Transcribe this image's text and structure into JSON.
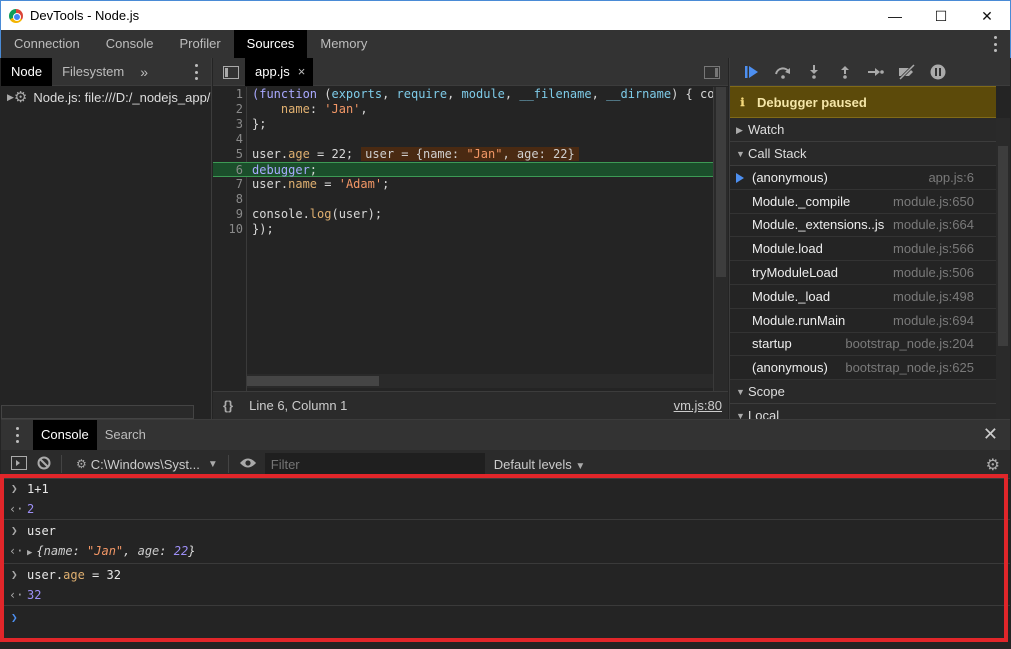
{
  "window": {
    "title": "DevTools - Node.js",
    "controls": {
      "minimize": "—",
      "maximize": "☐",
      "close": "✕"
    }
  },
  "main_tabs": [
    {
      "label": "Connection"
    },
    {
      "label": "Console"
    },
    {
      "label": "Profiler"
    },
    {
      "label": "Sources",
      "active": true
    },
    {
      "label": "Memory"
    }
  ],
  "navigator": {
    "tabs": [
      {
        "label": "Node",
        "active": true
      },
      {
        "label": "Filesystem"
      }
    ],
    "more": "»",
    "tree": [
      {
        "label": "Node.js: file:///D:/_nodejs_app/app.js"
      }
    ]
  },
  "editor": {
    "file_tab": "app.js",
    "close": "×",
    "lines": [
      {
        "n": "1"
      },
      {
        "n": "2"
      },
      {
        "n": "3"
      },
      {
        "n": "4"
      },
      {
        "n": "5"
      },
      {
        "n": "6"
      },
      {
        "n": "7"
      },
      {
        "n": "8"
      },
      {
        "n": "9"
      },
      {
        "n": "10"
      }
    ],
    "code": {
      "l1": {
        "kw": "(function",
        "sp1": " (",
        "p1": "exports",
        "c1": ", ",
        "p2": "require",
        "c2": ", ",
        "p3": "module",
        "c3": ", ",
        "p4": "__filename",
        "c4": ", ",
        "p5": "__dirname",
        "end": ") { con"
      },
      "l2": {
        "indent": "    ",
        "key": "name",
        "colon": ": ",
        "val": "'Jan'",
        "comma": ","
      },
      "l3": {
        "text": "};"
      },
      "l5": {
        "a": "user.",
        "prop": "age",
        "b": " = 22;",
        "inline_pre": "user = {name: ",
        "inline_str": "\"Jan\"",
        "inline_post": ", age: 22}"
      },
      "l6": {
        "kw": "debugger",
        "semi": ";"
      },
      "l7": {
        "a": "user.",
        "prop": "name",
        "b": " = ",
        "str": "'Adam'",
        "semi": ";"
      },
      "l9": {
        "a": "console.",
        "prop": "log",
        "b": "(user);"
      },
      "l10": {
        "text": "});"
      }
    },
    "status": {
      "braces": "{}",
      "position": "Line 6, Column 1",
      "source_link": "vm.js:80"
    }
  },
  "debugger": {
    "toolbar": [
      "resume-icon",
      "step-over-icon",
      "step-into-icon",
      "step-out-icon",
      "step-icon",
      "deactivate-breakpoints-icon",
      "pause-on-exceptions-icon"
    ],
    "paused": "Debugger paused",
    "sections": {
      "watch": "Watch",
      "call_stack": "Call Stack",
      "scope": "Scope",
      "local": "Local"
    },
    "call_stack": [
      {
        "fn": "(anonymous)",
        "loc": "app.js:6",
        "current": true
      },
      {
        "fn": "Module._compile",
        "loc": "module.js:650"
      },
      {
        "fn": "Module._extensions..js",
        "loc": "module.js:664"
      },
      {
        "fn": "Module.load",
        "loc": "module.js:566"
      },
      {
        "fn": "tryModuleLoad",
        "loc": "module.js:506"
      },
      {
        "fn": "Module._load",
        "loc": "module.js:498"
      },
      {
        "fn": "Module.runMain",
        "loc": "module.js:694"
      },
      {
        "fn": "startup",
        "loc": "bootstrap_node.js:204"
      },
      {
        "fn": "(anonymous)",
        "loc": "bootstrap_node.js:625"
      }
    ]
  },
  "drawer": {
    "tabs": [
      {
        "label": "Console",
        "active": true
      },
      {
        "label": "Search"
      }
    ],
    "close": "✕",
    "toolbar": {
      "context": "C:\\Windows\\Syst...",
      "filter_placeholder": "Filter",
      "levels": "Default levels"
    },
    "messages": {
      "in1": "1+1",
      "out1": "2",
      "in2": "user",
      "out2": {
        "open": "{",
        "key1": "name",
        "sep1": ": ",
        "val1": "\"Jan\"",
        "mid": ", ",
        "key2": "age",
        "sep2": ": ",
        "val2": "22",
        "close": "}"
      },
      "in3": {
        "a": "user.",
        "prop": "age",
        "b": " = 32"
      },
      "out3": "32"
    }
  },
  "colors": {
    "accent": "#4d8ff0",
    "highlight_box": "#e1262a",
    "paused_bg": "#5c4a0a"
  }
}
